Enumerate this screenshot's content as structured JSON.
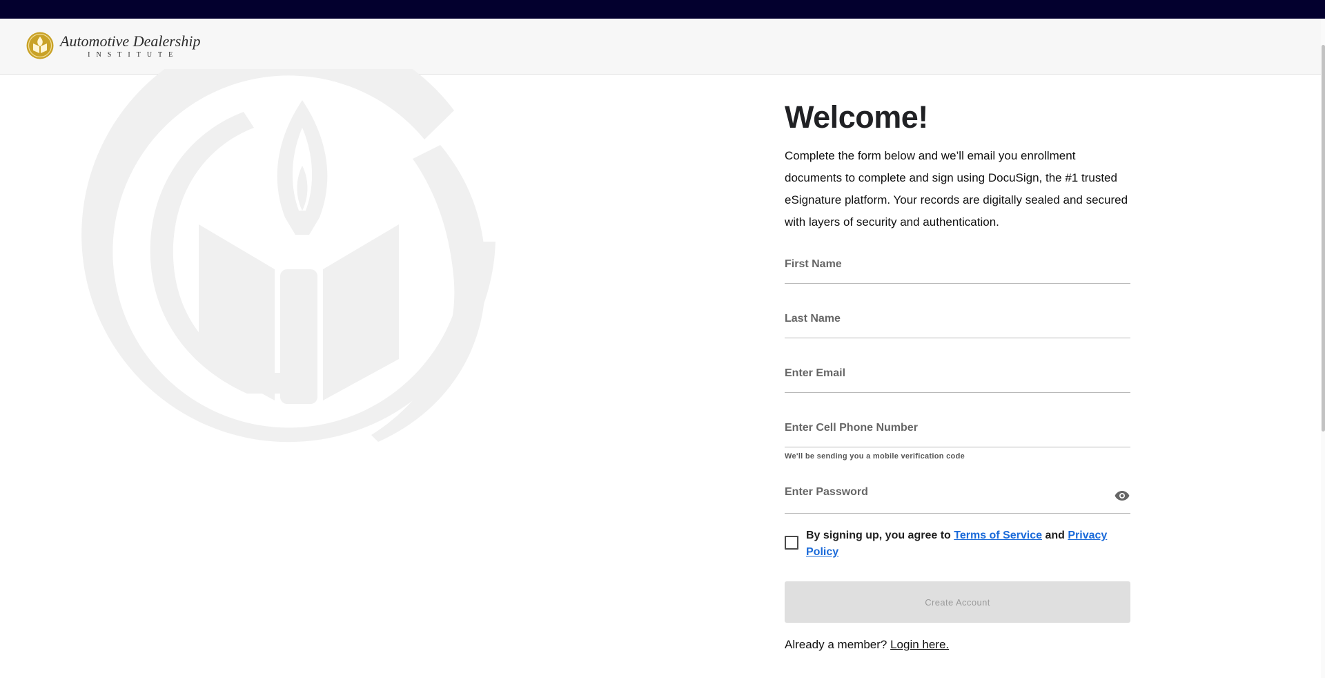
{
  "brand": {
    "title": "Automotive Dealership",
    "subtitle": "INSTITUTE",
    "logo_icon": "book-flame-logo-icon",
    "colors": {
      "topbar": "#03002e",
      "header": "#f7f7f7",
      "logo_gold": "#c9a227",
      "link": "#1a6ad9",
      "button_disabled": "#dfdfdf"
    }
  },
  "form": {
    "heading": "Welcome!",
    "intro": "Complete the form below and we’ll email you enrollment documents to complete and sign using DocuSign, the #1 trusted eSignature platform. Your records are digitally sealed and secured with layers of security and authentication.",
    "fields": {
      "first_name": {
        "placeholder": "First Name",
        "value": ""
      },
      "last_name": {
        "placeholder": "Last Name",
        "value": ""
      },
      "email": {
        "placeholder": "Enter Email",
        "value": ""
      },
      "phone": {
        "placeholder": "Enter Cell Phone Number",
        "value": "",
        "hint": "We'll be sending you a mobile verification code"
      },
      "password": {
        "placeholder": "Enter Password",
        "value": "",
        "toggle_icon": "eye-icon"
      }
    },
    "agreement": {
      "checked": false,
      "prefix": "By signing up, you agree to ",
      "terms_label": "Terms of Service",
      "conjunction": " and ",
      "privacy_label": "Privacy Policy"
    },
    "submit_label": "Create Account",
    "login_prompt": "Already a member? ",
    "login_link": "Login here."
  }
}
